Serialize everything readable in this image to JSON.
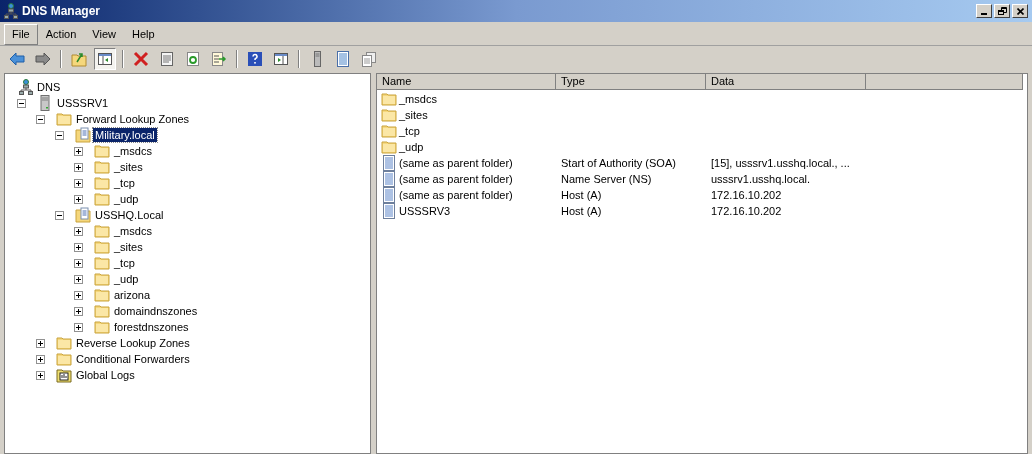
{
  "window": {
    "title": "DNS Manager",
    "controls": [
      {
        "kind": "minimize"
      },
      {
        "kind": "restore"
      },
      {
        "kind": "close"
      }
    ]
  },
  "menu": [
    {
      "label": "File",
      "selected": true
    },
    {
      "label": "Action",
      "selected": false
    },
    {
      "label": "View",
      "selected": false
    },
    {
      "label": "Help",
      "selected": false
    }
  ],
  "toolbar": [
    {
      "kind": "back",
      "pressed": false
    },
    {
      "kind": "forward",
      "pressed": false
    },
    {
      "kind": "separator"
    },
    {
      "kind": "up",
      "pressed": false
    },
    {
      "kind": "tree",
      "pressed": true
    },
    {
      "kind": "separator"
    },
    {
      "kind": "delete",
      "pressed": false
    },
    {
      "kind": "properties",
      "pressed": false
    },
    {
      "kind": "refresh",
      "pressed": false
    },
    {
      "kind": "export",
      "pressed": false
    },
    {
      "kind": "separator"
    },
    {
      "kind": "help",
      "pressed": false
    },
    {
      "kind": "pane",
      "pressed": false
    },
    {
      "kind": "separator"
    },
    {
      "kind": "server",
      "pressed": false
    },
    {
      "kind": "list",
      "pressed": false
    },
    {
      "kind": "copy",
      "pressed": false
    }
  ],
  "tree": {
    "label": "DNS",
    "kind": "dns",
    "selected": false,
    "children": [
      {
        "label": "USSSRV1",
        "kind": "server",
        "expanded": true,
        "selected": false,
        "children": [
          {
            "label": "Forward Lookup Zones",
            "kind": "folder",
            "expanded": true,
            "selected": false,
            "children": [
              {
                "label": "Military.local",
                "kind": "zone",
                "expanded": true,
                "selected": true,
                "children": [
                  {
                    "label": "_msdcs",
                    "kind": "folder",
                    "expanded": false,
                    "selected": false
                  },
                  {
                    "label": "_sites",
                    "kind": "folder",
                    "expanded": false,
                    "selected": false
                  },
                  {
                    "label": "_tcp",
                    "kind": "folder",
                    "expanded": false,
                    "selected": false
                  },
                  {
                    "label": "_udp",
                    "kind": "folder",
                    "expanded": false,
                    "selected": false
                  }
                ]
              },
              {
                "label": "USSHQ.Local",
                "kind": "zone",
                "expanded": true,
                "selected": false,
                "children": [
                  {
                    "label": "_msdcs",
                    "kind": "folder",
                    "expanded": false,
                    "selected": false
                  },
                  {
                    "label": "_sites",
                    "kind": "folder",
                    "expanded": false,
                    "selected": false
                  },
                  {
                    "label": "_tcp",
                    "kind": "folder",
                    "expanded": false,
                    "selected": false
                  },
                  {
                    "label": "_udp",
                    "kind": "folder",
                    "expanded": false,
                    "selected": false
                  },
                  {
                    "label": "arizona",
                    "kind": "folder",
                    "expanded": false,
                    "selected": false
                  },
                  {
                    "label": "domaindnszones",
                    "kind": "folder",
                    "expanded": false,
                    "selected": false
                  },
                  {
                    "label": "forestdnszones",
                    "kind": "folder",
                    "expanded": false,
                    "selected": false
                  }
                ]
              }
            ]
          },
          {
            "label": "Reverse Lookup Zones",
            "kind": "folder",
            "expanded": false,
            "selected": false
          },
          {
            "label": "Conditional Forwarders",
            "kind": "folder",
            "expanded": false,
            "selected": false
          },
          {
            "label": "Global Logs",
            "kind": "log",
            "expanded": false,
            "selected": false
          }
        ]
      }
    ]
  },
  "table": {
    "columns": [
      "Name",
      "Type",
      "Data"
    ],
    "rows": [
      {
        "kind": "folder",
        "name": "_msdcs"
      },
      {
        "kind": "folder",
        "name": "_sites"
      },
      {
        "kind": "folder",
        "name": "_tcp"
      },
      {
        "kind": "folder",
        "name": "_udp"
      },
      {
        "kind": "record",
        "name": "(same as parent folder)",
        "type": "Start of Authority (SOA)",
        "data": "[15], usssrv1.usshq.local., ..."
      },
      {
        "kind": "record",
        "name": "(same as parent folder)",
        "type": "Name Server (NS)",
        "data": "usssrv1.usshq.local."
      },
      {
        "kind": "record",
        "name": "(same as parent folder)",
        "type": "Host (A)",
        "data": "172.16.10.202"
      },
      {
        "kind": "record",
        "name": "USSSRV3",
        "type": "Host (A)",
        "data": "172.16.10.202"
      }
    ]
  }
}
